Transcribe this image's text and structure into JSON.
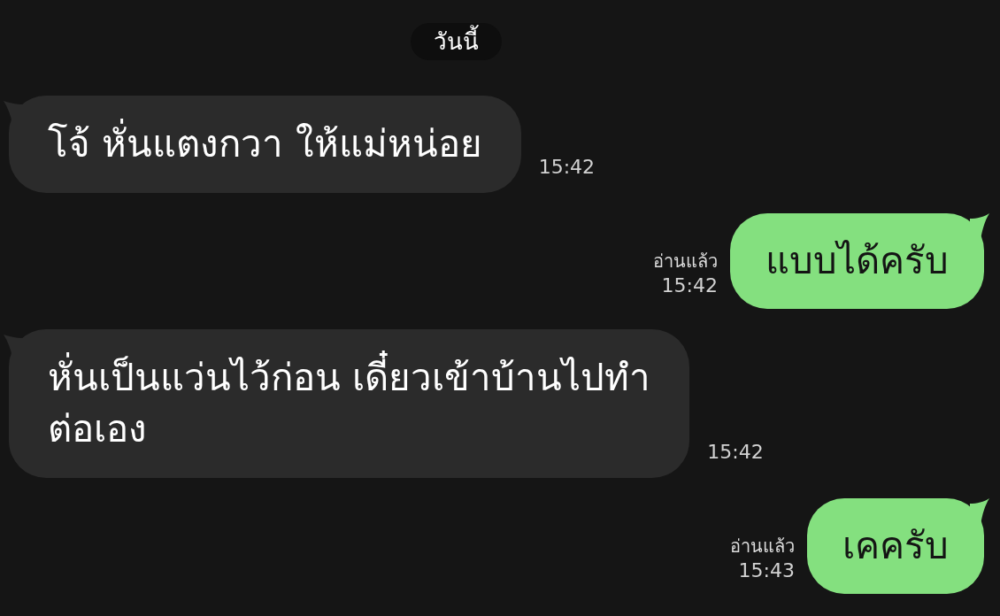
{
  "date_label": "วันนี้",
  "messages": [
    {
      "kind": "incoming",
      "lines": [
        "โจ้ หั่นแตงกวา ให้แม่หน่อย"
      ],
      "time": "15:42"
    },
    {
      "kind": "outgoing",
      "lines": [
        "แบบได้ครับ"
      ],
      "read_label": "อ่านแล้ว",
      "time": "15:42"
    },
    {
      "kind": "incoming",
      "lines": [
        "หั่นเป็นแว่นไว้ก่อน เดี๋ยวเข้าบ้านไปทำ",
        "ต่อเอง"
      ],
      "time": "15:42"
    },
    {
      "kind": "outgoing",
      "lines": [
        "เคครับ"
      ],
      "read_label": "อ่านแล้ว",
      "time": "15:43"
    }
  ]
}
